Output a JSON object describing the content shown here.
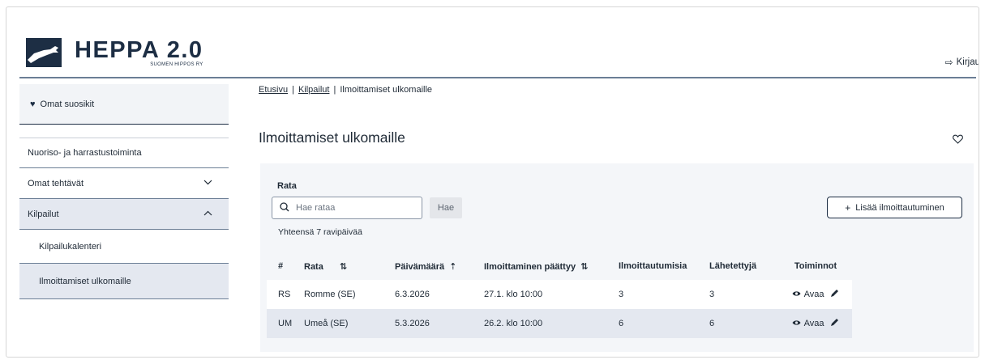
{
  "header": {
    "logo_title": "HEPPA 2.0",
    "logo_subtitle": "SUOMEN HIPPOS RY",
    "login_label": "Kirjau",
    "login_icon": "login-icon"
  },
  "sidebar": {
    "favorites_label": "Omat suosikit",
    "items": [
      {
        "label": "Nuoriso- ja harrastustoiminta"
      },
      {
        "label": "Omat tehtävät",
        "chevron": "⌄"
      },
      {
        "label": "Kilpailut",
        "chevron": "⌃"
      },
      {
        "label": "Kilpailukalenteri"
      },
      {
        "label": "Ilmoittamiset ulkomaille"
      }
    ]
  },
  "breadcrumb": {
    "home": "Etusivu",
    "separator": "|",
    "parent": "Kilpailut",
    "current": "Ilmoittamiset ulkomaille"
  },
  "page": {
    "title": "Ilmoittamiset ulkomaille"
  },
  "filter": {
    "label": "Rata",
    "search_placeholder": "Hae rataa",
    "search_button": "Hae",
    "add_button": "Lisää ilmoittautuminen",
    "total": "Yhteensä 7 ravipäivää"
  },
  "table": {
    "headers": {
      "id": "#",
      "rata": "Rata",
      "date": "Päivämäärä",
      "end": "Ilmoittaminen päättyy",
      "registrations": "Ilmoittautumisia",
      "sent": "Lähetettyjä",
      "actions": "Toiminnot"
    },
    "rows": [
      {
        "id": "RS",
        "rata": "Romme (SE)",
        "date": "6.3.2026",
        "end": "27.1. klo 10:00",
        "registrations": "3",
        "sent": "3",
        "open": "Avaa"
      },
      {
        "id": "UM",
        "rata": "Umeå (SE)",
        "date": "5.3.2026",
        "end": "26.2. klo 10:00",
        "registrations": "6",
        "sent": "6",
        "open": "Avaa"
      }
    ]
  },
  "colors": {
    "brand": "#1d2e44",
    "active_bg": "#e4e8f0",
    "panel_bg": "#f4f6f9"
  }
}
